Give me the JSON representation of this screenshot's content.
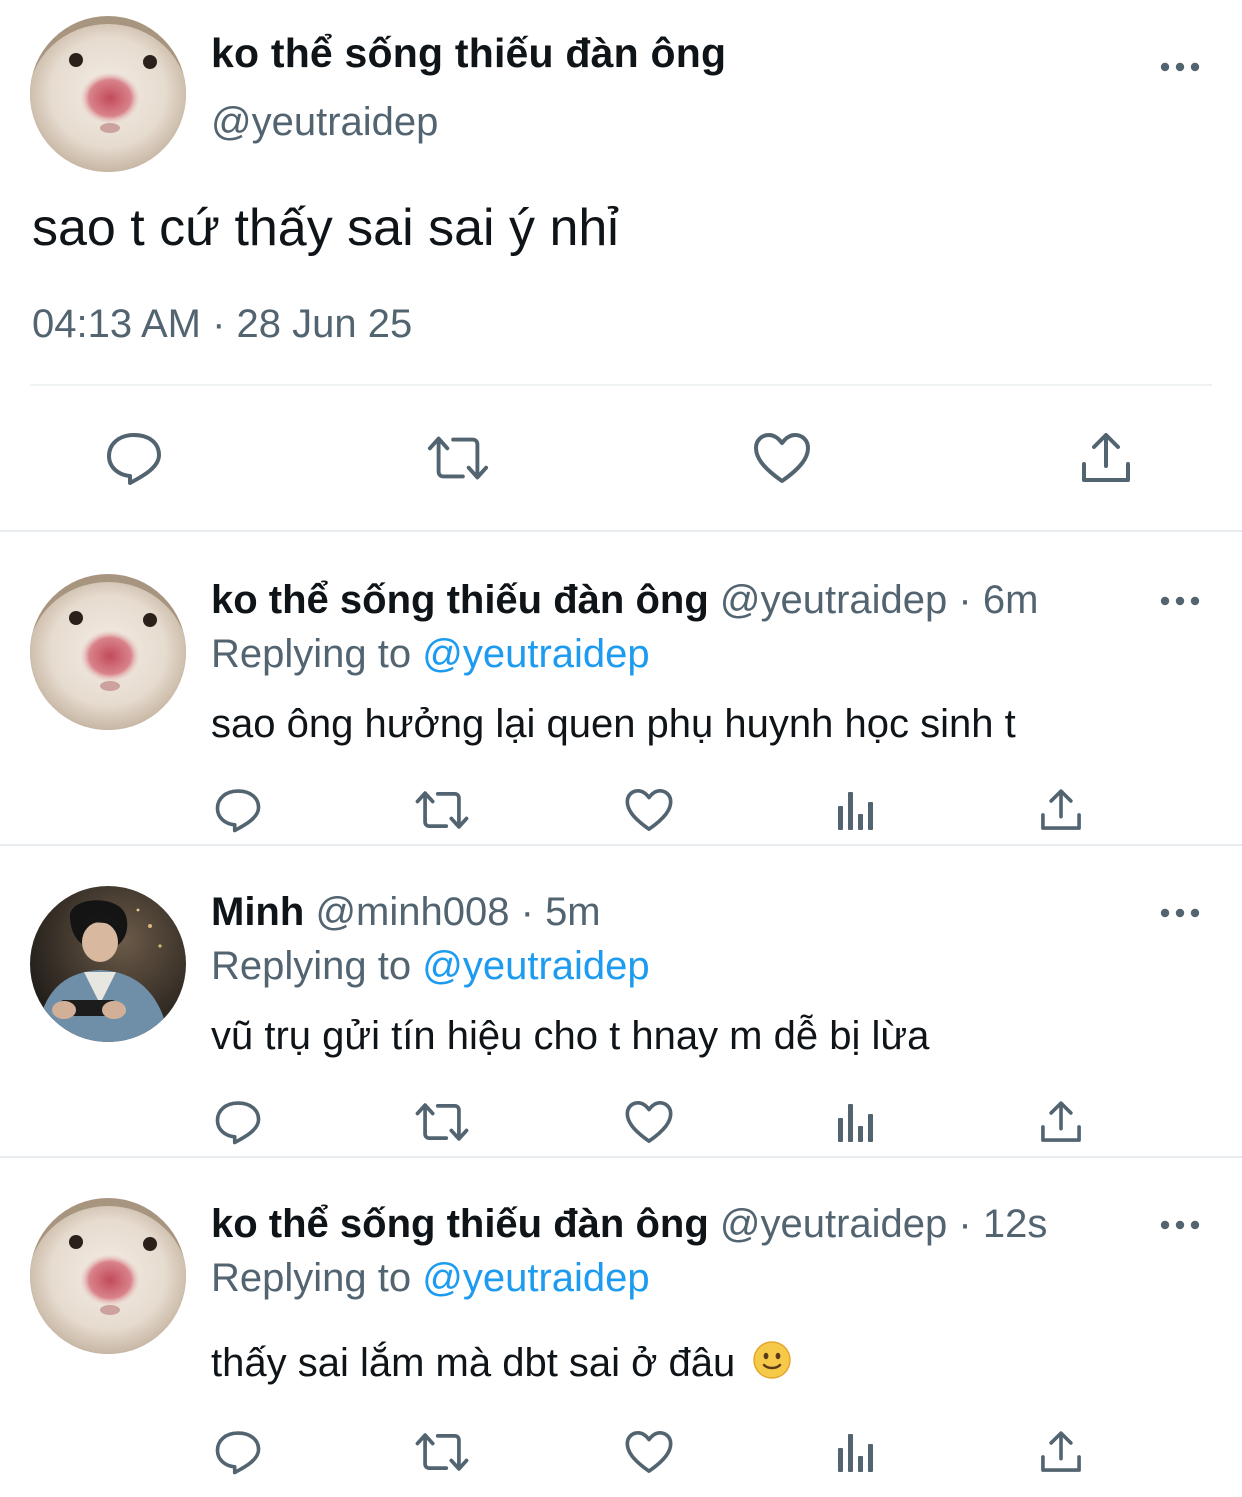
{
  "main_tweet": {
    "author_name": "ko thể sống thiếu đàn ông",
    "author_handle": "@yeutraidep",
    "text": "sao t cứ thấy sai sai ý nhỉ",
    "timestamp": "04:13 AM · 28 Jun 25",
    "avatar_icon": "hamster-avatar",
    "actions": [
      "reply-icon",
      "retweet-icon",
      "like-icon",
      "share-icon"
    ]
  },
  "replies": [
    {
      "author_name": "ko thể sống thiếu đàn ông",
      "author_handle": "@yeutraidep",
      "separator": "·",
      "time": "6m",
      "replying_prefix": "Replying to ",
      "replying_to": "@yeutraidep",
      "text": "sao ông hưởng lại quen phụ huynh học sinh t",
      "avatar_icon": "hamster-avatar"
    },
    {
      "author_name": "Minh",
      "author_handle": "@minh008",
      "separator": "·",
      "time": "5m",
      "replying_prefix": "Replying to ",
      "replying_to": "@yeutraidep",
      "text": "vũ trụ gửi tín hiệu cho t hnay m dễ bị lừa",
      "avatar_icon": "person-denim-avatar"
    },
    {
      "author_name": "ko thể sống thiếu đàn ông",
      "author_handle": "@yeutraidep",
      "separator": "·",
      "time": "12s",
      "replying_prefix": "Replying to ",
      "replying_to": "@yeutraidep",
      "text": "thấy sai lắm mà dbt sai ở đâu",
      "trailing_emoji": "slightly-smiling-face-icon",
      "avatar_icon": "hamster-avatar"
    }
  ],
  "reply_actions": [
    "reply-icon",
    "retweet-icon",
    "like-icon",
    "analytics-icon",
    "share-icon"
  ],
  "colors": {
    "text_primary": "#0f1419",
    "text_secondary": "#536471",
    "link": "#1d9bf0",
    "icon": "#536471",
    "divider": "#eff3f4"
  }
}
